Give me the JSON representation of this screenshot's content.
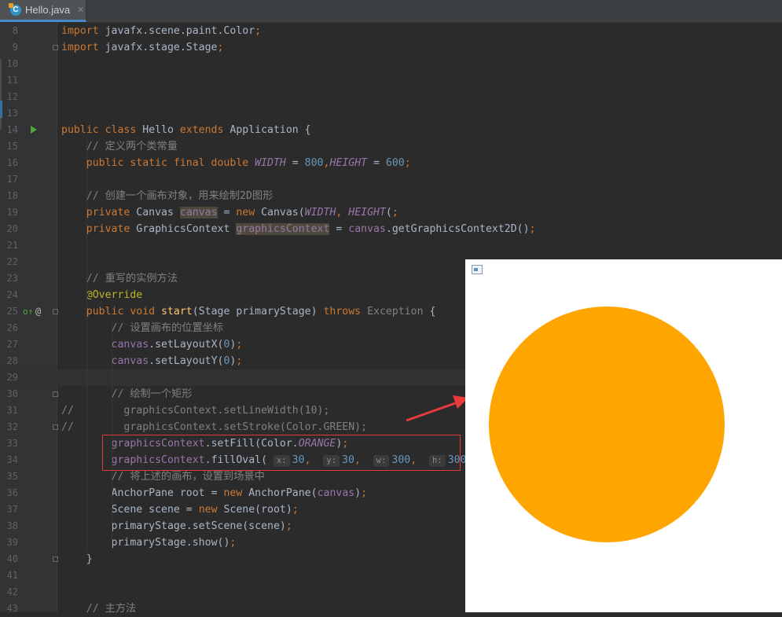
{
  "tab": {
    "label": "Hello.java",
    "icon": "java-class-icon"
  },
  "lines": [
    {
      "n": "8",
      "tokens": [
        [
          "kw",
          "import "
        ],
        [
          "",
          "javafx.scene.paint.Color"
        ],
        [
          "kw",
          ";"
        ]
      ]
    },
    {
      "n": "9",
      "tokens": [
        [
          "kw",
          "import "
        ],
        [
          "",
          "javafx.stage.Stage"
        ],
        [
          "kw",
          ";"
        ]
      ]
    },
    {
      "n": "10",
      "tokens": []
    },
    {
      "n": "11",
      "tokens": []
    },
    {
      "n": "12",
      "tokens": []
    },
    {
      "n": "13",
      "tokens": []
    },
    {
      "n": "14",
      "tokens": [
        [
          "kw",
          "public class "
        ],
        [
          "",
          "Hello "
        ],
        [
          "kw",
          "extends "
        ],
        [
          "",
          "Application {"
        ]
      ]
    },
    {
      "n": "15",
      "tokens": [
        [
          "",
          "    "
        ],
        [
          "cm",
          "// 定义两个类常量"
        ]
      ]
    },
    {
      "n": "16",
      "tokens": [
        [
          "",
          "    "
        ],
        [
          "kw",
          "public static final double "
        ],
        [
          "cst",
          "WIDTH"
        ],
        [
          "",
          " = "
        ],
        [
          "num",
          "800"
        ],
        [
          "kw",
          ","
        ],
        [
          "cst",
          "HEIGHT"
        ],
        [
          "",
          " = "
        ],
        [
          "num",
          "600"
        ],
        [
          "kw",
          ";"
        ]
      ]
    },
    {
      "n": "17",
      "tokens": []
    },
    {
      "n": "18",
      "tokens": [
        [
          "",
          "    "
        ],
        [
          "cm",
          "// 创建一个画布对象，用来绘制2D图形"
        ]
      ]
    },
    {
      "n": "19",
      "tokens": [
        [
          "",
          "    "
        ],
        [
          "kw",
          "private "
        ],
        [
          "",
          "Canvas "
        ],
        [
          "fld hl",
          "canvas"
        ],
        [
          "",
          " = "
        ],
        [
          "kw",
          "new "
        ],
        [
          "",
          "Canvas("
        ],
        [
          "cst",
          "WIDTH"
        ],
        [
          "kw",
          ", "
        ],
        [
          "cst",
          "HEIGHT"
        ],
        [
          "",
          "("
        ],
        [
          "kw",
          ";"
        ]
      ]
    },
    {
      "n": "20",
      "tokens": [
        [
          "",
          "    "
        ],
        [
          "kw",
          "private "
        ],
        [
          "",
          "GraphicsContext "
        ],
        [
          "fld hl",
          "graphicsContext"
        ],
        [
          "",
          " = "
        ],
        [
          "fld",
          "canvas"
        ],
        [
          "",
          ".getGraphicsContext2D()"
        ],
        [
          "kw",
          ";"
        ]
      ]
    },
    {
      "n": "21",
      "tokens": []
    },
    {
      "n": "22",
      "tokens": []
    },
    {
      "n": "23",
      "tokens": [
        [
          "",
          "    "
        ],
        [
          "cm",
          "// 重写的实例方法"
        ]
      ]
    },
    {
      "n": "24",
      "tokens": [
        [
          "",
          "    "
        ],
        [
          "ann",
          "@Override"
        ]
      ]
    },
    {
      "n": "25",
      "tokens": [
        [
          "",
          "    "
        ],
        [
          "kw",
          "public void "
        ],
        [
          "mth",
          "start"
        ],
        [
          "",
          "(Stage primaryStage) "
        ],
        [
          "kw",
          "throws "
        ],
        [
          "gray",
          "Exception"
        ],
        [
          "",
          " {"
        ]
      ]
    },
    {
      "n": "26",
      "tokens": [
        [
          "",
          "        "
        ],
        [
          "cm",
          "// 设置画布的位置坐标"
        ]
      ]
    },
    {
      "n": "27",
      "tokens": [
        [
          "",
          "        "
        ],
        [
          "fld",
          "canvas"
        ],
        [
          "",
          ".setLayoutX("
        ],
        [
          "num",
          "0"
        ],
        [
          "",
          ")"
        ],
        [
          "kw",
          ";"
        ]
      ]
    },
    {
      "n": "28",
      "tokens": [
        [
          "",
          "        "
        ],
        [
          "fld",
          "canvas"
        ],
        [
          "",
          ".setLayoutY("
        ],
        [
          "num",
          "0"
        ],
        [
          "",
          ")"
        ],
        [
          "kw",
          ";"
        ]
      ]
    },
    {
      "n": "29",
      "tokens": []
    },
    {
      "n": "30",
      "tokens": [
        [
          "",
          "        "
        ],
        [
          "cm",
          "// 绘制一个矩形"
        ]
      ]
    },
    {
      "n": "31",
      "tokens": [
        [
          "cm",
          "//        graphicsContext.setLineWidth(10);"
        ]
      ]
    },
    {
      "n": "32",
      "tokens": [
        [
          "cm",
          "//        graphicsContext.setStroke(Color.GREEN);"
        ]
      ]
    },
    {
      "n": "33",
      "tokens": [
        [
          "",
          "        "
        ],
        [
          "fld",
          "graphicsContext"
        ],
        [
          "",
          ".setFill(Color."
        ],
        [
          "cst",
          "ORANGE"
        ],
        [
          "",
          ")"
        ],
        [
          "kw",
          ";"
        ]
      ]
    },
    {
      "n": "34",
      "tokens": [
        [
          "",
          "        "
        ],
        [
          "fld",
          "graphicsContext"
        ],
        [
          "",
          ".fillOval( "
        ],
        [
          "hint",
          "x:"
        ],
        [
          "num",
          "30"
        ],
        [
          "kw",
          ",  "
        ],
        [
          "hint",
          "y:"
        ],
        [
          "num",
          "30"
        ],
        [
          "kw",
          ",  "
        ],
        [
          "hint",
          "w:"
        ],
        [
          "num",
          "300"
        ],
        [
          "kw",
          ",  "
        ],
        [
          "hint",
          "h:"
        ],
        [
          "num",
          "300"
        ],
        [
          "",
          ")"
        ],
        [
          "kw",
          ";"
        ]
      ]
    },
    {
      "n": "35",
      "tokens": [
        [
          "",
          "        "
        ],
        [
          "cm",
          "// 将上述的画布，设置到场景中"
        ]
      ]
    },
    {
      "n": "36",
      "tokens": [
        [
          "",
          "        "
        ],
        [
          "",
          "AnchorPane root = "
        ],
        [
          "kw",
          "new "
        ],
        [
          "",
          "AnchorPane("
        ],
        [
          "fld",
          "canvas"
        ],
        [
          "",
          ")"
        ],
        [
          "kw",
          ";"
        ]
      ]
    },
    {
      "n": "37",
      "tokens": [
        [
          "",
          "        "
        ],
        [
          "",
          "Scene scene = "
        ],
        [
          "kw",
          "new "
        ],
        [
          "",
          "Scene(root)"
        ],
        [
          "kw",
          ";"
        ]
      ]
    },
    {
      "n": "38",
      "tokens": [
        [
          "",
          "        "
        ],
        [
          "",
          "primaryStage.setScene(scene)"
        ],
        [
          "kw",
          ";"
        ]
      ]
    },
    {
      "n": "39",
      "tokens": [
        [
          "",
          "        "
        ],
        [
          "",
          "primaryStage.show()"
        ],
        [
          "kw",
          ";"
        ]
      ]
    },
    {
      "n": "40",
      "tokens": [
        [
          "",
          "    }"
        ]
      ]
    },
    {
      "n": "41",
      "tokens": []
    },
    {
      "n": "42",
      "tokens": []
    },
    {
      "n": "43",
      "tokens": [
        [
          "",
          "    "
        ],
        [
          "cm",
          "// 主方法"
        ]
      ]
    }
  ],
  "colors": {
    "oval_fill": "#ffa500",
    "annotation_box": "#e03a3a",
    "arrow": "#e83a3a"
  }
}
